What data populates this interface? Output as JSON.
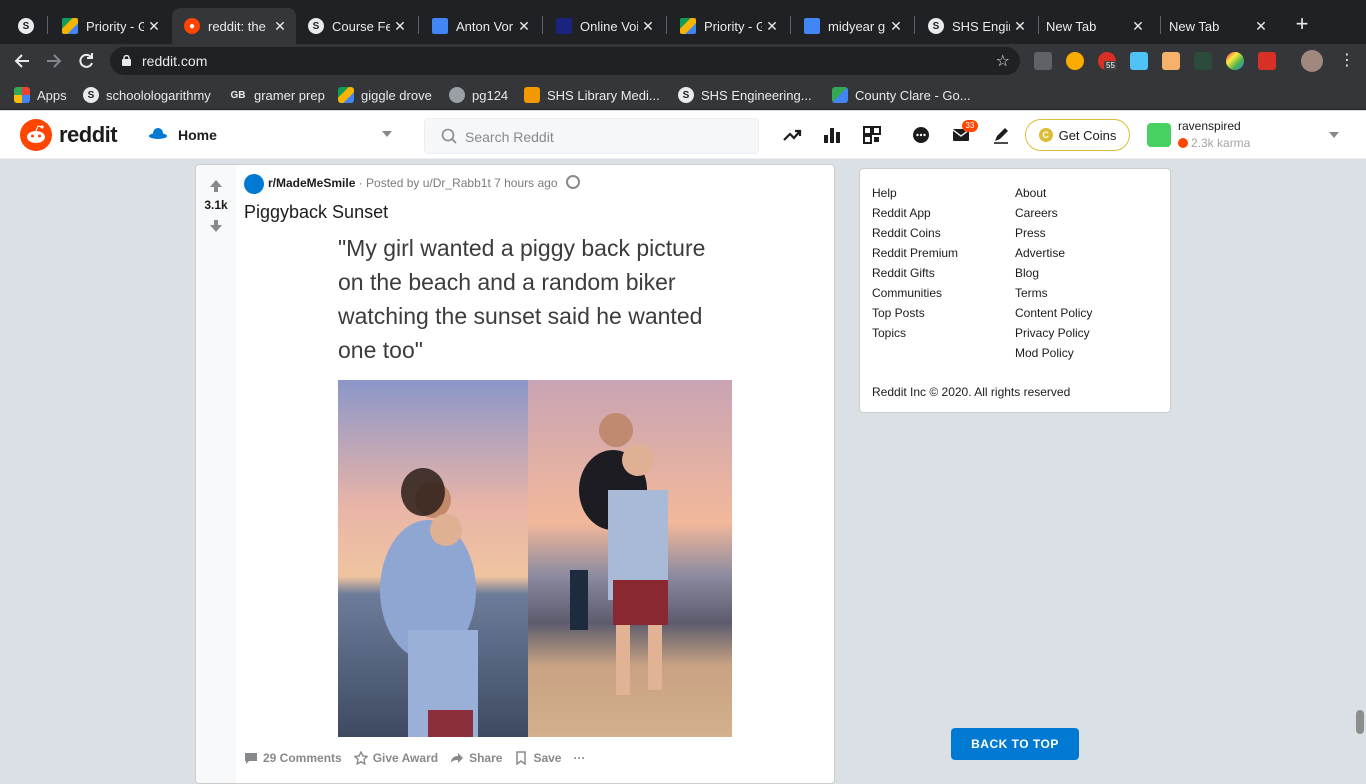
{
  "browser": {
    "tabs": [
      {
        "title": "",
        "icon": "s-circle-icon",
        "active": false
      },
      {
        "title": "Priority - G",
        "icon": "drive-icon",
        "active": false
      },
      {
        "title": "reddit: the",
        "icon": "reddit-icon",
        "active": true
      },
      {
        "title": "Course Fe",
        "icon": "s-circle-icon",
        "active": false
      },
      {
        "title": "Anton Vor",
        "icon": "docs-icon",
        "active": false
      },
      {
        "title": "Online Voi",
        "icon": "voice-icon",
        "active": false
      },
      {
        "title": "Priority - G",
        "icon": "drive-icon",
        "active": false
      },
      {
        "title": "midyear g",
        "icon": "docs-icon",
        "active": false
      },
      {
        "title": "SHS Engin",
        "icon": "s-circle-icon",
        "active": false
      },
      {
        "title": "New Tab",
        "icon": "",
        "active": false
      },
      {
        "title": "New Tab",
        "icon": "",
        "active": false
      }
    ],
    "new_tab": "+",
    "url": "reddit.com",
    "ext_badge": "55",
    "bookmarks": [
      {
        "label": "Apps",
        "icon": "apps-grid-icon"
      },
      {
        "label": "schoolologarithmy",
        "icon": "s-circle-icon"
      },
      {
        "label": "gramer prep",
        "icon": "gb-icon"
      },
      {
        "label": "giggle drove",
        "icon": "drive-icon"
      },
      {
        "label": "pg124",
        "icon": "globe-icon"
      },
      {
        "label": "SHS Library Medi...",
        "icon": "library-icon"
      },
      {
        "label": "SHS Engineering...",
        "icon": "s-circle-icon"
      },
      {
        "label": "County Clare - Go...",
        "icon": "maps-icon"
      }
    ]
  },
  "reddit": {
    "wordmark": "reddit",
    "feed": "Home",
    "search_placeholder": "Search Reddit",
    "mail_count": "33",
    "get_coins": "Get Coins",
    "coin_symbol": "C",
    "username": "ravenspired",
    "karma": "2.3k karma"
  },
  "post": {
    "votes": "3.1k",
    "subreddit": "r/MadeMeSmile",
    "meta": "· Posted by u/Dr_Rabb1t 7 hours ago",
    "title": "Piggyback Sunset",
    "image_quote": "\"My girl wanted a piggy back picture on the beach and a random biker watching the sunset said he wanted one too\"",
    "actions": {
      "comments": "29 Comments",
      "award": "Give Award",
      "share": "Share",
      "save": "Save",
      "more": "···"
    }
  },
  "footer": {
    "col1": [
      "Help",
      "Reddit App",
      "Reddit Coins",
      "Reddit Premium",
      "Reddit Gifts",
      "Communities",
      "Top Posts",
      "Topics"
    ],
    "col2": [
      "About",
      "Careers",
      "Press",
      "Advertise",
      "Blog",
      "Terms",
      "Content Policy",
      "Privacy Policy",
      "Mod Policy"
    ],
    "copyright": "Reddit Inc © 2020. All rights reserved"
  },
  "back_to_top": "BACK TO TOP",
  "colors": {
    "reddit_orange": "#ff4500",
    "reddit_blue": "#0079d3",
    "coin_gold": "#ddbd37"
  }
}
